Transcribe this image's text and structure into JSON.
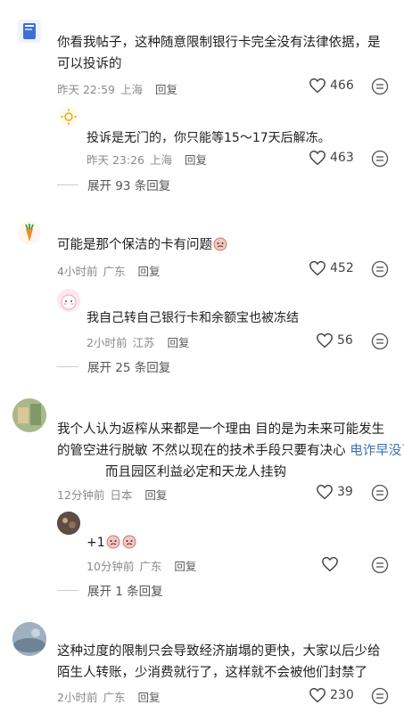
{
  "comments": [
    {
      "text_lines": [
        "你看我帖子，这种随意限制银行卡完全没有法律依据，是",
        "可以投诉的"
      ],
      "time": "昨天 22:59",
      "location": "上海",
      "reply_label": "回复",
      "likes": "466",
      "replies": [
        {
          "text_lines": [
            "投诉是无门的，你只能等15～17天后解冻。"
          ],
          "time": "昨天 23:26",
          "location": "上海",
          "reply_label": "回复",
          "likes": "463"
        }
      ],
      "expand_label": "展开 93 条回复"
    },
    {
      "text_lines": [
        "可能是那个保洁的卡有问题"
      ],
      "time": "4小时前",
      "location": "广东",
      "reply_label": "回复",
      "likes": "452",
      "replies": [
        {
          "text_lines": [
            "我自己转自己银行卡和余额宝也被冻结"
          ],
          "time": "2小时前",
          "location": "江苏",
          "reply_label": "回复",
          "likes": "56"
        }
      ],
      "expand_label": "展开 25 条回复"
    },
    {
      "text_lines": [
        "我个人认为返榨从来都是一个理由 目的是为未来可能发生",
        "的管空进行脱敏 不然以现在的技术手段只要有决心 ",
        "而且园区利益必定和天龙人挂钩"
      ],
      "link_text": "电诈早没了",
      "time": "12分钟前",
      "location": "日本",
      "reply_label": "回复",
      "likes": "39",
      "replies": [
        {
          "text_lines": [
            "+1"
          ],
          "time": "10分钟前",
          "location": "广东",
          "reply_label": "回复",
          "likes": ""
        }
      ],
      "expand_label": "展开 1 条回复"
    },
    {
      "text_lines": [
        "这种过度的限制只会导致经济崩塌的更快，大家以后少给",
        "陌生人转账，少消费就行了，这样就不会被他们封禁了"
      ],
      "time": "2小时前",
      "location": "广东",
      "reply_label": "回复",
      "likes": "230"
    }
  ],
  "icons": {
    "like": "heart-icon",
    "more": "more-dots-icon"
  },
  "colors": {
    "link": "#3b6fb6",
    "meta": "#8a8a8a"
  }
}
